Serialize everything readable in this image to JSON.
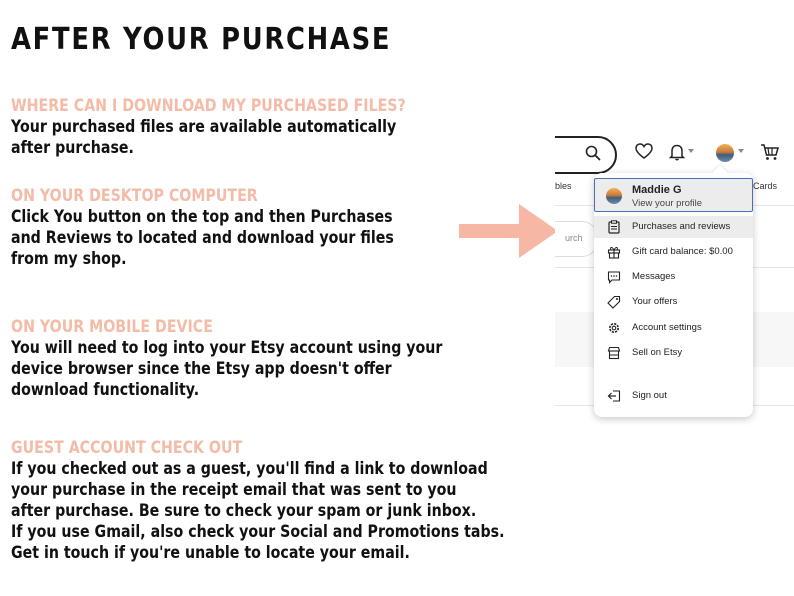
{
  "title": "AFTER YOUR PURCHASE",
  "sections": [
    {
      "heading": "WHERE CAN I DOWNLOAD MY PURCHASED FILES?",
      "lines": [
        "Your purchased files are available automatically",
        "after purchase."
      ]
    },
    {
      "heading": "ON YOUR DESKTOP COMPUTER",
      "lines": [
        "Click You button on the top and then Purchases",
        "and Reviews to located and download your files",
        "from my shop."
      ]
    },
    {
      "heading": "ON YOUR MOBILE DEVICE",
      "lines": [
        "You will need to log into your Etsy account using your",
        "device browser since the Etsy app doesn't offer",
        "download functionality."
      ]
    },
    {
      "heading": "GUEST ACCOUNT CHECK OUT",
      "lines": [
        "If you checked out as a guest, you'll find a link to download",
        "your purchase in the receipt email that was sent to you",
        "after purchase. Be sure to check your spam or junk inbox.",
        "If you use Gmail, also check your Social and Promotions tabs.",
        "Get in touch if you're unable to locate your email."
      ]
    }
  ],
  "screenshot": {
    "nav_left_fragment": "bles",
    "nav_right_fragment": "Cards",
    "search_fragment": "urch",
    "menu": {
      "profile_name": "Maddie G",
      "profile_sub": "View your profile",
      "items": [
        {
          "label": "Purchases and reviews",
          "icon": "clipboard-icon"
        },
        {
          "label": "Gift card balance: $0.00",
          "icon": "gift-icon"
        },
        {
          "label": "Messages",
          "icon": "message-icon"
        },
        {
          "label": "Your offers",
          "icon": "tag-icon"
        },
        {
          "label": "Account settings",
          "icon": "gear-icon"
        },
        {
          "label": "Sell on Etsy",
          "icon": "shop-icon"
        },
        {
          "label": "Sign out",
          "icon": "sign-out-icon"
        }
      ]
    }
  },
  "colors": {
    "heading": "#f4bba7",
    "arrow": "#f6b8a5",
    "body": "#111111",
    "highlight_border": "#4a6fb8"
  }
}
